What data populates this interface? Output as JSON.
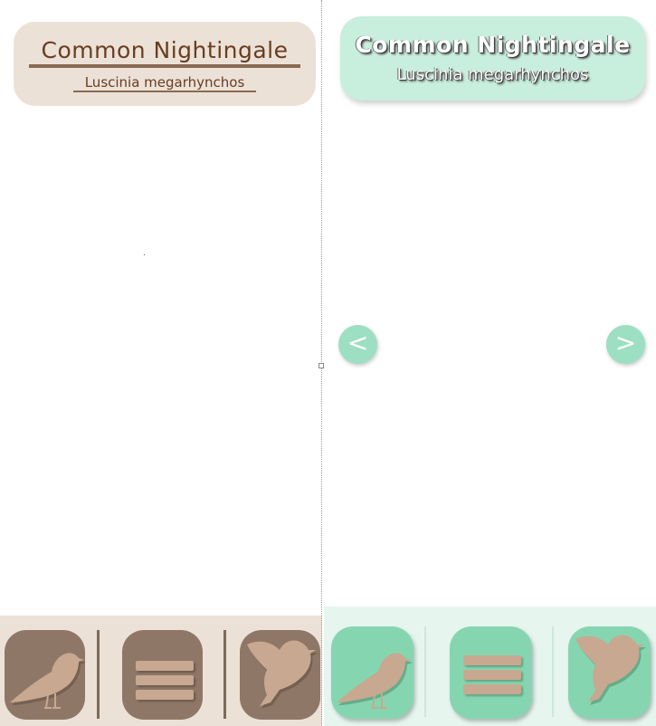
{
  "species": {
    "common_name": "Common Nightingale",
    "scientific_name": "Luscinia megarhynchos"
  },
  "navigation": {
    "prev_label": "<",
    "next_label": ">"
  },
  "colors": {
    "left_theme_card": "#ebe1d7",
    "left_theme_button": "#8f7767",
    "left_theme_text": "#6a3d1f",
    "right_theme_card": "#c8eedd",
    "right_theme_button": "#85d6b0",
    "right_theme_arrow": "#9ddfc2",
    "bird_icon_fill": "#c8a890"
  },
  "bottom_bar": {
    "buttons": [
      {
        "id": "perched-bird",
        "icon": "perched-bird-icon"
      },
      {
        "id": "menu",
        "icon": "menu-icon"
      },
      {
        "id": "flying-bird",
        "icon": "flying-bird-icon"
      }
    ]
  }
}
